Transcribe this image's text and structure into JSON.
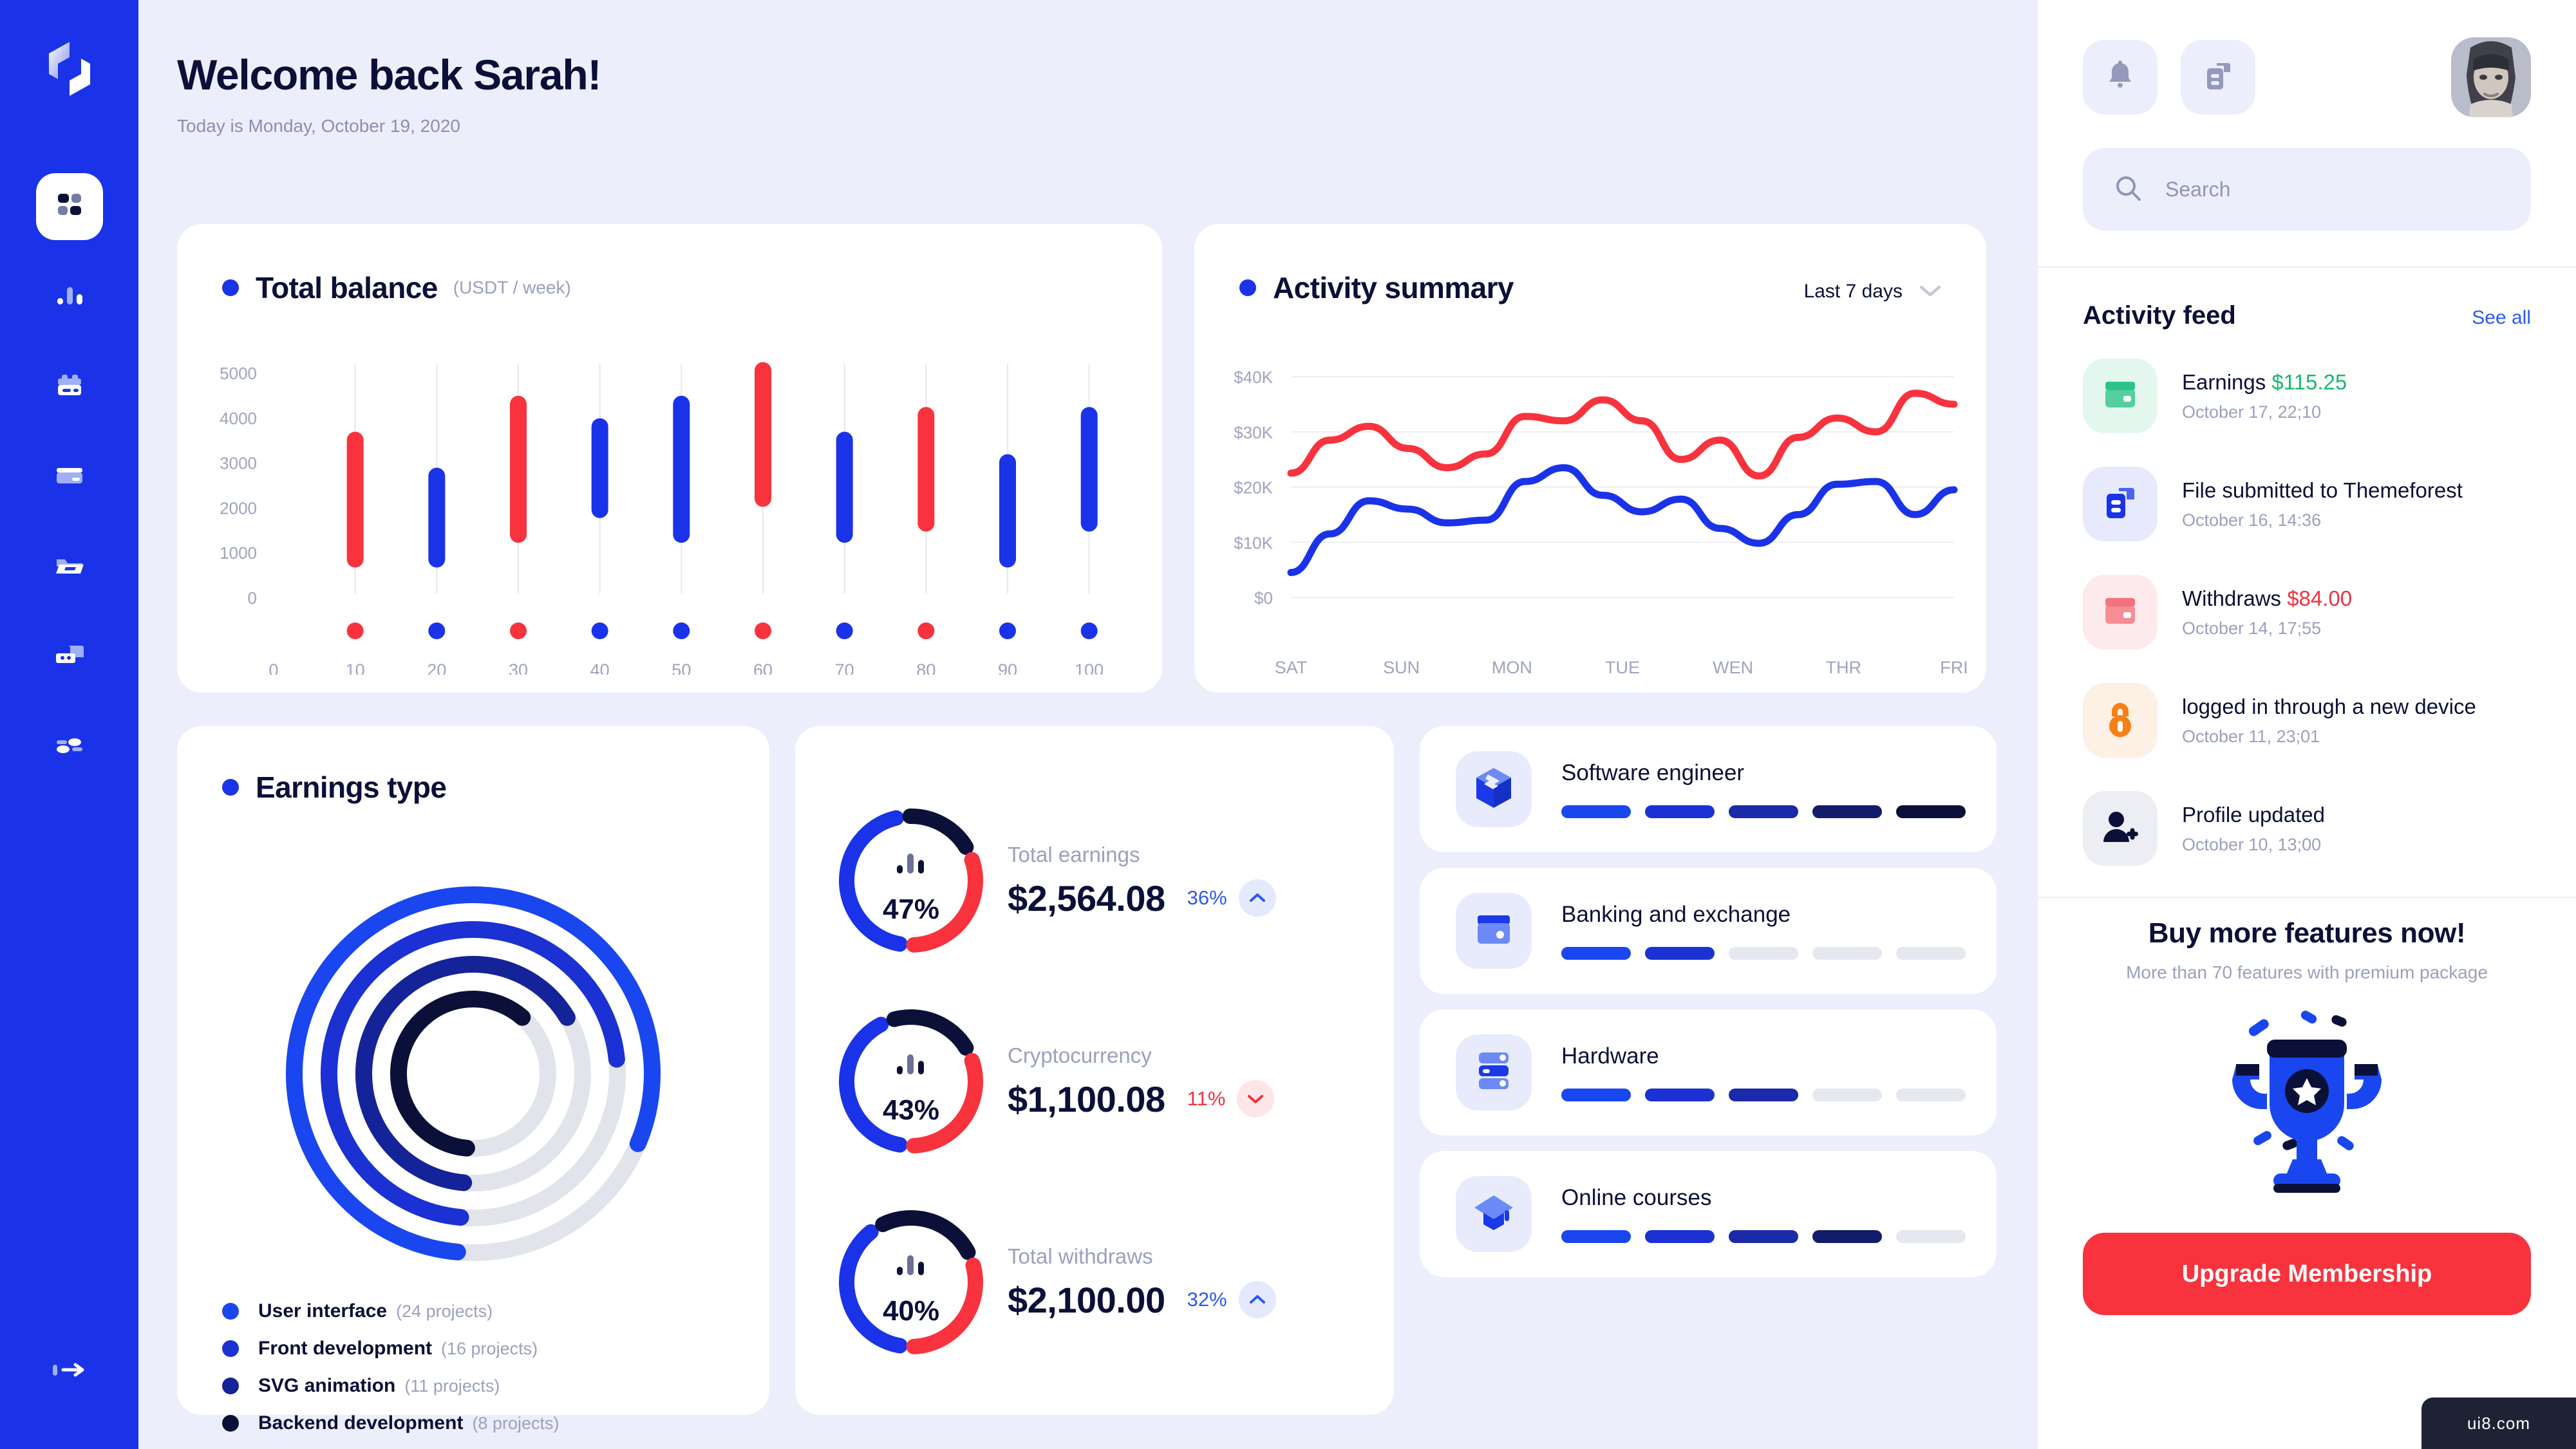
{
  "brand": {
    "accent": "#1a33e8",
    "accent_light": "#2f58f5",
    "danger": "#f8333e",
    "dark": "#0b1038"
  },
  "sidebar": {
    "items": [
      {
        "name": "dashboard",
        "icon": "grid-icon",
        "active": true
      },
      {
        "name": "analytics",
        "icon": "bar-chart-icon",
        "active": false
      },
      {
        "name": "wallet",
        "icon": "wallet-icon",
        "active": false
      },
      {
        "name": "cards",
        "icon": "credit-card-icon",
        "active": false
      },
      {
        "name": "files",
        "icon": "folder-icon",
        "active": false
      },
      {
        "name": "messages",
        "icon": "chat-icon",
        "active": false
      },
      {
        "name": "settings",
        "icon": "sliders-icon",
        "active": false
      }
    ],
    "logout": {
      "label": "logout",
      "icon": "logout-arrow-icon"
    }
  },
  "greeting": {
    "title": "Welcome back Sarah!",
    "subtitle": "Today is Monday, October 19, 2020"
  },
  "balance_card": {
    "title": "Total balance",
    "subtitle": "(USDT / week)"
  },
  "activity_card": {
    "title": "Activity summary",
    "range_label": "Last 7 days"
  },
  "earnings_card": {
    "title": "Earnings type",
    "legend": [
      {
        "label": "User interface",
        "count": "(24 projects)",
        "color": "#1a46f0"
      },
      {
        "label": "Front development",
        "count": "(16 projects)",
        "color": "#1b31d4"
      },
      {
        "label": "SVG animation",
        "count": "(11 projects)",
        "color": "#152399"
      },
      {
        "label": "Backend development",
        "count": "(8 projects)",
        "color": "#0b1038"
      }
    ]
  },
  "stats": [
    {
      "name": "Total earnings",
      "value": "$2,564.08",
      "percent": "47%",
      "delta": "36%",
      "direction": "up",
      "segments": [
        {
          "color": "#1a33e8",
          "value": 47
        },
        {
          "color": "#0b1038",
          "value": 20
        },
        {
          "color": "#f8333e",
          "value": 33
        }
      ]
    },
    {
      "name": "Cryptocurrency",
      "value": "$1,100.08",
      "percent": "43%",
      "delta": "11%",
      "direction": "down",
      "segments": [
        {
          "color": "#1a33e8",
          "value": 43
        },
        {
          "color": "#0b1038",
          "value": 24
        },
        {
          "color": "#f8333e",
          "value": 33
        }
      ]
    },
    {
      "name": "Total withdraws",
      "value": "$2,100.00",
      "percent": "40%",
      "delta": "32%",
      "direction": "up",
      "segments": [
        {
          "color": "#1a33e8",
          "value": 40
        },
        {
          "color": "#0b1038",
          "value": 28
        },
        {
          "color": "#f8333e",
          "value": 32
        }
      ]
    }
  ],
  "skills": [
    {
      "name": "Software engineer",
      "icon": "cube-icon",
      "filled": 5
    },
    {
      "name": "Banking and exchange",
      "icon": "wallet-icon",
      "filled": 2
    },
    {
      "name": "Hardware",
      "icon": "server-icon",
      "filled": 3
    },
    {
      "name": "Online courses",
      "icon": "cap-icon",
      "filled": 4
    }
  ],
  "skill_palette": [
    "#1a46f0",
    "#1b31d4",
    "#1a2aa8",
    "#121c6b",
    "#0b1038"
  ],
  "skill_empty_color": "#e6e8f0",
  "topbar": {
    "notifications_icon": "bell-icon",
    "files_icon": "files-icon",
    "avatar_name": "user-avatar"
  },
  "search": {
    "placeholder": "Search",
    "value": "",
    "icon": "search-icon"
  },
  "feed": {
    "title": "Activity feed",
    "see_all": "See all",
    "items": [
      {
        "text": "Earnings ",
        "amount": "$115.25",
        "amount_color": "#19b872",
        "time": "October 17, 22;10",
        "icon": "wallet-icon",
        "bg": "#e4f7ee",
        "fg": "#2bc486"
      },
      {
        "text": "File submitted to Themeforest",
        "amount": "",
        "amount_color": "",
        "time": "October 16, 14:36",
        "icon": "files-icon",
        "bg": "#e7eafd",
        "fg": "#1a33e8"
      },
      {
        "text": "Withdraws ",
        "amount": "$84.00",
        "amount_color": "#f03340",
        "time": "October 14, 17;55",
        "icon": "credit-card-icon",
        "bg": "#fdeaec",
        "fg": "#f4727c"
      },
      {
        "text": "logged in through a new device",
        "amount": "",
        "amount_color": "",
        "time": "October 11, 23;01",
        "icon": "lock-icon",
        "bg": "#fdf0e4",
        "fg": "#f58016"
      },
      {
        "text": "Profile updated",
        "amount": "",
        "amount_color": "",
        "time": "October 10, 13;00",
        "icon": "user-plus-icon",
        "bg": "#eceef3",
        "fg": "#0b1038"
      }
    ]
  },
  "promo": {
    "title": "Buy more features now!",
    "subtitle": "More than 70 features with premium package",
    "art": "trophy-illustration",
    "button": "Upgrade Membership"
  },
  "watermark": {
    "text": "ui8.com"
  },
  "chart_data": [
    {
      "type": "bar",
      "variant": "floating-range-bar",
      "title": "Total balance",
      "subtitle": "(USDT / week)",
      "xlabel": "",
      "ylabel": "",
      "xlim": [
        0,
        105
      ],
      "ylim": [
        0,
        5300
      ],
      "xticks": [
        0,
        10,
        20,
        30,
        40,
        50,
        60,
        70,
        80,
        90,
        100
      ],
      "yticks": [
        0,
        1000,
        2000,
        3000,
        4000,
        5000
      ],
      "grid": "vertical",
      "colors": {
        "up": "#1a33e8",
        "down": "#f8333e"
      },
      "points": [
        {
          "x": 10,
          "low": 850,
          "high": 3500,
          "color": "#f8333e"
        },
        {
          "x": 20,
          "low": 850,
          "high": 2700,
          "color": "#1a33e8"
        },
        {
          "x": 30,
          "low": 1400,
          "high": 4300,
          "color": "#f8333e"
        },
        {
          "x": 40,
          "low": 1950,
          "high": 3800,
          "color": "#1a33e8"
        },
        {
          "x": 50,
          "low": 1400,
          "high": 4300,
          "color": "#1a33e8"
        },
        {
          "x": 60,
          "low": 2200,
          "high": 5050,
          "color": "#f8333e"
        },
        {
          "x": 70,
          "low": 1400,
          "high": 3500,
          "color": "#1a33e8"
        },
        {
          "x": 80,
          "low": 1650,
          "high": 4050,
          "color": "#f8333e"
        },
        {
          "x": 90,
          "low": 850,
          "high": 3000,
          "color": "#1a33e8"
        },
        {
          "x": 100,
          "low": 1650,
          "high": 4050,
          "color": "#1a33e8"
        }
      ]
    },
    {
      "type": "line",
      "title": "Activity summary",
      "xlabel": "",
      "ylabel": "",
      "categories": [
        "SAT",
        "SUN",
        "MON",
        "TUE",
        "WEN",
        "THR",
        "FRI"
      ],
      "yticks": [
        0,
        10000,
        20000,
        30000,
        40000
      ],
      "ytick_labels": [
        "$0",
        "$10K",
        "$20K",
        "$30K",
        "$40K"
      ],
      "ylim": [
        0,
        42000
      ],
      "grid": "horizontal",
      "legend": "none",
      "series": [
        {
          "name": "red",
          "color": "#f8333e",
          "values": [
            22500,
            28500,
            31000,
            27000,
            23500,
            26000,
            32800,
            32000,
            35800,
            32000,
            25000,
            28500,
            22000,
            29000,
            32500,
            30000,
            37000,
            35000
          ]
        },
        {
          "name": "blue",
          "color": "#1a33e8",
          "values": [
            4500,
            11500,
            17500,
            16000,
            13500,
            14000,
            21000,
            23500,
            18500,
            15500,
            17800,
            12500,
            9800,
            15000,
            20500,
            21000,
            15000,
            19500
          ]
        }
      ]
    },
    {
      "type": "pie",
      "variant": "concentric-rings",
      "title": "Earnings type",
      "categories": [
        "User interface",
        "Front development",
        "SVG animation",
        "Backend development"
      ],
      "values": [
        24,
        16,
        11,
        8
      ],
      "value_suffix": "projects",
      "colors": [
        "#1a46f0",
        "#1b31d4",
        "#152399",
        "#0b1038"
      ],
      "track_color": "#e2e4ec",
      "fractions": [
        0.8,
        0.72,
        0.65,
        0.6
      ]
    }
  ]
}
